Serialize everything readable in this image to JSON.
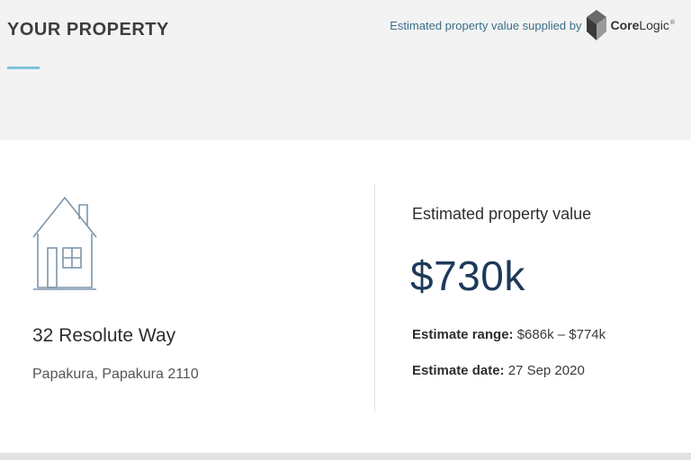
{
  "header": {
    "title": "YOUR PROPERTY",
    "supplier_text": "Estimated property value supplied by",
    "logo": {
      "icon": "corelogic-logo-icon",
      "text_bold": "Core",
      "text_light": "Logic",
      "reg": "®"
    }
  },
  "property": {
    "icon": "house-icon",
    "street": "32 Resolute Way",
    "suburb": "Papakura, Papakura 2110"
  },
  "valuation": {
    "label": "Estimated property value",
    "amount": "$730k",
    "range_label": "Estimate range:",
    "range_value": " $686k – $774k",
    "date_label": "Estimate date:",
    "date_value": " 27 Sep 2020"
  },
  "colors": {
    "accent": "#7cc4d9",
    "value": "#1e3a5a",
    "supplier_text": "#3b6f8a"
  }
}
